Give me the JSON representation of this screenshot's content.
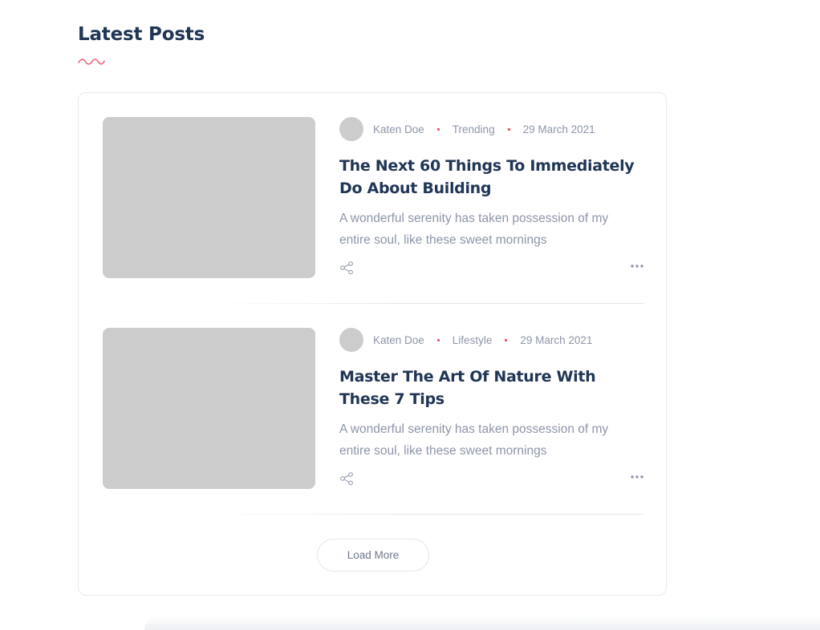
{
  "section": {
    "title": "Latest Posts",
    "accent_color": "#f05a6e",
    "title_color": "#203656"
  },
  "posts": [
    {
      "author": "Katen Doe",
      "category": "Trending",
      "date": "29 March 2021",
      "title": "The Next 60 Things To Immediately Do About Building",
      "excerpt": "A wonderful serenity has taken possession of my entire soul, like these sweet mornings",
      "share_icon": "share-icon",
      "more_icon": "more-horizontal-icon"
    },
    {
      "author": "Katen Doe",
      "category": "Lifestyle",
      "date": "29 March 2021",
      "title": "Master The Art Of Nature With These 7 Tips",
      "excerpt": "A wonderful serenity has taken possession of my entire soul, like these sweet mornings",
      "share_icon": "share-icon",
      "more_icon": "more-horizontal-icon"
    }
  ],
  "load_more": {
    "label": "Load More"
  }
}
